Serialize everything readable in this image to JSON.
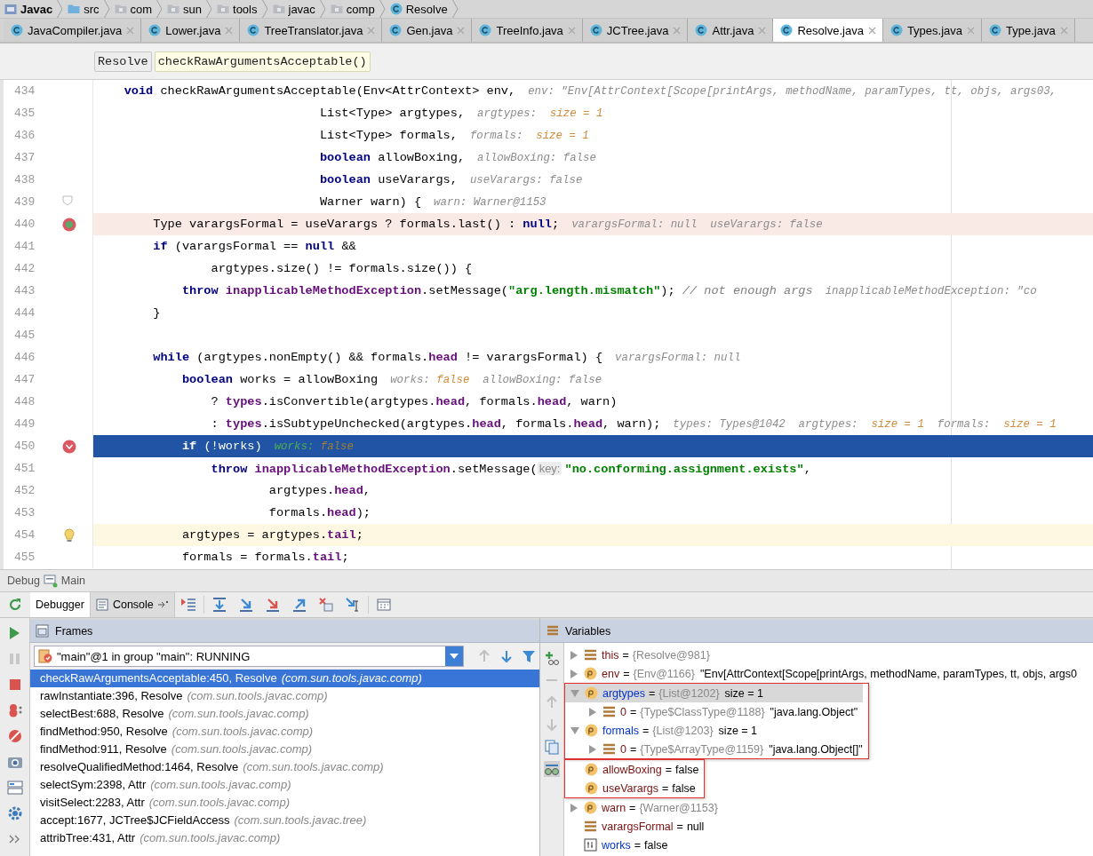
{
  "breadcrumbs": [
    {
      "kind": "module",
      "label": "Javac"
    },
    {
      "kind": "folder",
      "label": "src"
    },
    {
      "kind": "package",
      "label": "com"
    },
    {
      "kind": "package",
      "label": "sun"
    },
    {
      "kind": "package",
      "label": "tools"
    },
    {
      "kind": "package",
      "label": "javac"
    },
    {
      "kind": "package",
      "label": "comp"
    },
    {
      "kind": "class",
      "label": "Resolve"
    }
  ],
  "tabs": [
    {
      "label": "JavaCompiler.java",
      "selected": false
    },
    {
      "label": "Lower.java",
      "selected": false
    },
    {
      "label": "TreeTranslator.java",
      "selected": false
    },
    {
      "label": "Gen.java",
      "selected": false
    },
    {
      "label": "TreeInfo.java",
      "selected": false
    },
    {
      "label": "JCTree.java",
      "selected": false
    },
    {
      "label": "Attr.java",
      "selected": false
    },
    {
      "label": "Resolve.java",
      "selected": true
    },
    {
      "label": "Types.java",
      "selected": false
    },
    {
      "label": "Type.java",
      "selected": false
    }
  ],
  "editor_crumbs": [
    {
      "label": "Resolve",
      "selected": false
    },
    {
      "label": "checkRawArgumentsAcceptable()",
      "selected": true
    }
  ],
  "lines": [
    {
      "number": "434",
      "code": [
        {
          "kind": "keyword",
          "text": "    void"
        },
        {
          "kind": "plain",
          "text": " checkRawArgumentsAcceptable(Env<AttrContext> env,"
        }
      ],
      "hints": [
        {
          "kind": "name",
          "text": "env: \"Env[AttrContext[Scope[printArgs, methodName, paramTypes, tt, objs, args03,"
        }
      ]
    },
    {
      "number": "435",
      "code": [
        {
          "kind": "plain",
          "text": "                               List<Type> argtypes,"
        }
      ],
      "hints": [
        {
          "kind": "name",
          "text": "argtypes:  "
        },
        {
          "kind": "value",
          "text": "size = 1"
        }
      ]
    },
    {
      "number": "436",
      "code": [
        {
          "kind": "plain",
          "text": "                               List<Type> formals,"
        }
      ],
      "hints": [
        {
          "kind": "name",
          "text": "formals:  "
        },
        {
          "kind": "value",
          "text": "size = 1"
        }
      ]
    },
    {
      "number": "437",
      "code": [
        {
          "kind": "keyword",
          "text": "                               boolean"
        },
        {
          "kind": "plain",
          "text": " allowBoxing,"
        }
      ],
      "hints": [
        {
          "kind": "name",
          "text": "allowBoxing: false"
        }
      ]
    },
    {
      "number": "438",
      "code": [
        {
          "kind": "keyword",
          "text": "                               boolean"
        },
        {
          "kind": "plain",
          "text": " useVarargs,"
        }
      ],
      "hints": [
        {
          "kind": "name",
          "text": "useVarargs: false"
        }
      ]
    },
    {
      "number": "439",
      "fold": true,
      "code": [
        {
          "kind": "plain",
          "text": "                               Warner warn) {"
        }
      ],
      "hints": [
        {
          "kind": "name",
          "text": "warn: Warner@1153"
        }
      ]
    },
    {
      "number": "440",
      "breakpoint": true,
      "code": [
        {
          "kind": "plain",
          "text": "        Type varargsFormal = useVarargs ? formals.last() : "
        },
        {
          "kind": "keyword",
          "text": "null"
        },
        {
          "kind": "plain",
          "text": ";"
        }
      ],
      "hints": [
        {
          "kind": "name",
          "text": "varargsFormal: null  useVarargs: false"
        }
      ]
    },
    {
      "number": "441",
      "code": [
        {
          "kind": "keyword",
          "text": "        if"
        },
        {
          "kind": "plain",
          "text": " (varargsFormal == "
        },
        {
          "kind": "keyword",
          "text": "null"
        },
        {
          "kind": "plain",
          "text": " &&"
        }
      ]
    },
    {
      "number": "442",
      "code": [
        {
          "kind": "plain",
          "text": "                argtypes.size() != formals.size()) {"
        }
      ]
    },
    {
      "number": "443",
      "code": [
        {
          "kind": "keyword",
          "text": "            throw "
        },
        {
          "kind": "field",
          "text": "inapplicableMethodException"
        },
        {
          "kind": "plain",
          "text": ".setMessage("
        },
        {
          "kind": "string",
          "text": "\"arg.length.mismatch\""
        },
        {
          "kind": "plain",
          "text": "); "
        },
        {
          "kind": "comment",
          "text": "// not enough args"
        }
      ],
      "hints": [
        {
          "kind": "name",
          "text": "inapplicableMethodException: \"co"
        }
      ]
    },
    {
      "number": "444",
      "code": [
        {
          "kind": "plain",
          "text": "        }"
        }
      ]
    },
    {
      "number": "445"
    },
    {
      "number": "446",
      "code": [
        {
          "kind": "keyword",
          "text": "        while"
        },
        {
          "kind": "plain",
          "text": " (argtypes.nonEmpty() && formals."
        },
        {
          "kind": "field",
          "text": "head"
        },
        {
          "kind": "plain",
          "text": " != varargsFormal) {"
        }
      ],
      "hints": [
        {
          "kind": "name",
          "text": "varargsFormal: null"
        }
      ]
    },
    {
      "number": "447",
      "code": [
        {
          "kind": "keyword",
          "text": "            boolean"
        },
        {
          "kind": "plain",
          "text": " works = allowBoxing"
        }
      ],
      "hints": [
        {
          "kind": "name",
          "text": "works: "
        },
        {
          "kind": "value",
          "text": "false"
        },
        {
          "kind": "name",
          "text": "  allowBoxing: false"
        }
      ]
    },
    {
      "number": "448",
      "code": [
        {
          "kind": "plain",
          "text": "                ? "
        },
        {
          "kind": "field",
          "text": "types"
        },
        {
          "kind": "plain",
          "text": ".isConvertible(argtypes."
        },
        {
          "kind": "field",
          "text": "head"
        },
        {
          "kind": "plain",
          "text": ", formals."
        },
        {
          "kind": "field",
          "text": "head"
        },
        {
          "kind": "plain",
          "text": ", warn)"
        }
      ]
    },
    {
      "number": "449",
      "code": [
        {
          "kind": "plain",
          "text": "                : "
        },
        {
          "kind": "field",
          "text": "types"
        },
        {
          "kind": "plain",
          "text": ".isSubtypeUnchecked(argtypes."
        },
        {
          "kind": "field",
          "text": "head"
        },
        {
          "kind": "plain",
          "text": ", formals."
        },
        {
          "kind": "field",
          "text": "head"
        },
        {
          "kind": "plain",
          "text": ", warn);"
        }
      ],
      "hints": [
        {
          "kind": "name",
          "text": "types: Types@1042  argtypes:  "
        },
        {
          "kind": "value",
          "text": "size = 1"
        },
        {
          "kind": "name",
          "text": "  formals:  "
        },
        {
          "kind": "value",
          "text": "size = 1"
        }
      ]
    },
    {
      "number": "450",
      "breakpoint": true,
      "current": true,
      "code": [
        {
          "kind": "keyword",
          "text": "            if"
        },
        {
          "kind": "plain",
          "text": " (!works)"
        }
      ],
      "hints": [
        {
          "kind": "current",
          "text": "works: "
        },
        {
          "kind": "value",
          "text": "false"
        }
      ]
    },
    {
      "number": "451",
      "code": [
        {
          "kind": "keyword",
          "text": "                throw "
        },
        {
          "kind": "field",
          "text": "inapplicableMethodException"
        },
        {
          "kind": "plain",
          "text": ".setMessage("
        },
        {
          "kind": "param",
          "text": "key:"
        },
        {
          "kind": "string",
          "text": "\"no.conforming.assignment.exists\""
        },
        {
          "kind": "plain",
          "text": ","
        }
      ]
    },
    {
      "number": "452",
      "code": [
        {
          "kind": "plain",
          "text": "                        argtypes."
        },
        {
          "kind": "field",
          "text": "head"
        },
        {
          "kind": "plain",
          "text": ","
        }
      ]
    },
    {
      "number": "453",
      "code": [
        {
          "kind": "plain",
          "text": "                        formals."
        },
        {
          "kind": "field",
          "text": "head"
        },
        {
          "kind": "plain",
          "text": ");"
        }
      ]
    },
    {
      "number": "454",
      "caret": true,
      "intention": true,
      "code": [
        {
          "kind": "plain",
          "text": "            argtypes = argtypes."
        },
        {
          "kind": "field",
          "text": "tail"
        },
        {
          "kind": "plain",
          "text": ";"
        }
      ]
    },
    {
      "number": "455",
      "code": [
        {
          "kind": "plain",
          "text": "            formals = formals."
        },
        {
          "kind": "field",
          "text": "tail"
        },
        {
          "kind": "plain",
          "text": ";"
        }
      ]
    }
  ],
  "debug": {
    "title": "Debug",
    "config": "Main",
    "tabs": [
      {
        "label": "Debugger",
        "selected": true
      },
      {
        "label": "Console",
        "selected": false
      }
    ],
    "frames": {
      "title": "Frames",
      "thread": "\"main\"@1 in group \"main\": RUNNING",
      "items": [
        {
          "method": "checkRawArgumentsAcceptable:450, Resolve",
          "package": "(com.sun.tools.javac.comp)",
          "selected": true
        },
        {
          "method": "rawInstantiate:396, Resolve",
          "package": "(com.sun.tools.javac.comp)",
          "selected": false
        },
        {
          "method": "selectBest:688, Resolve",
          "package": "(com.sun.tools.javac.comp)",
          "selected": false
        },
        {
          "method": "findMethod:950, Resolve",
          "package": "(com.sun.tools.javac.comp)",
          "selected": false
        },
        {
          "method": "findMethod:911, Resolve",
          "package": "(com.sun.tools.javac.comp)",
          "selected": false
        },
        {
          "method": "resolveQualifiedMethod:1464, Resolve",
          "package": "(com.sun.tools.javac.comp)",
          "selected": false
        },
        {
          "method": "selectSym:2398, Attr",
          "package": "(com.sun.tools.javac.comp)",
          "selected": false
        },
        {
          "method": "visitSelect:2283, Attr",
          "package": "(com.sun.tools.javac.comp)",
          "selected": false
        },
        {
          "method": "accept:1677, JCTree$JCFieldAccess",
          "package": "(com.sun.tools.javac.tree)",
          "selected": false
        },
        {
          "method": "attribTree:431, Attr",
          "package": "(com.sun.tools.javac.comp)",
          "selected": false
        }
      ]
    },
    "variables": {
      "title": "Variables",
      "items": [
        {
          "kind": "field",
          "name": "this",
          "eq": "=",
          "ref": "{Resolve@981}",
          "expanded": false,
          "changed": false,
          "selected": false
        },
        {
          "kind": "param",
          "name": "env",
          "eq": "=",
          "ref": "{Env@1166}",
          "value": "\"Env[AttrContext[Scope[printArgs, methodName, paramTypes, tt, objs, args0",
          "expanded": false,
          "changed": false,
          "selected": false
        },
        {
          "kind": "callout",
          "items": [
            {
              "kind": "param",
              "name": "argtypes",
              "eq": "=",
              "ref": "{List@1202}",
              "value": "size = 1",
              "expanded": true,
              "changed": true,
              "selected": true,
              "children": [
                {
                  "kind": "field",
                  "name": "0",
                  "eq": "=",
                  "ref": "{Type$ClassType@1188}",
                  "value": "\"java.lang.Object\"",
                  "expanded": false,
                  "changed": false,
                  "selected": false
                }
              ]
            },
            {
              "kind": "param",
              "name": "formals",
              "eq": "=",
              "ref": "{List@1203}",
              "value": "size = 1",
              "expanded": true,
              "changed": true,
              "selected": false,
              "children": [
                {
                  "kind": "field",
                  "name": "0",
                  "eq": "=",
                  "ref": "{Type$ArrayType@1159}",
                  "value": "\"java.lang.Object[]\"",
                  "expanded": false,
                  "changed": false,
                  "selected": false
                }
              ]
            }
          ]
        },
        {
          "kind": "callout",
          "items": [
            {
              "kind": "param",
              "name": "allowBoxing",
              "eq": "=",
              "value": "false",
              "changed": false,
              "selected": false
            },
            {
              "kind": "param",
              "name": "useVarargs",
              "eq": "=",
              "value": "false",
              "changed": false,
              "selected": false
            }
          ]
        },
        {
          "kind": "param",
          "name": "warn",
          "eq": "=",
          "ref": "{Warner@1153}",
          "expanded": false,
          "changed": false,
          "selected": false
        },
        {
          "kind": "field",
          "name": "varargsFormal",
          "eq": "=",
          "value": "null",
          "changed": false,
          "selected": false
        },
        {
          "kind": "boolean",
          "name": "works",
          "eq": "=",
          "value": "false",
          "changed": true,
          "selected": false
        }
      ]
    }
  }
}
